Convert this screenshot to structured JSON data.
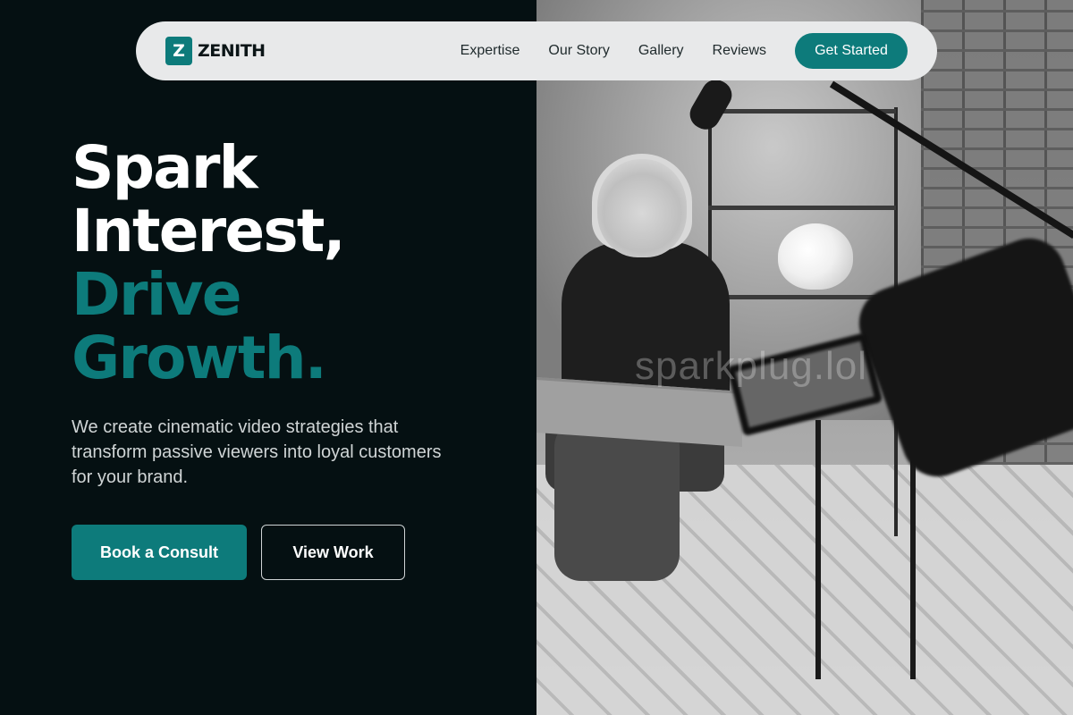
{
  "nav": {
    "logo_mark": "Z",
    "logo_text": "ZENITH",
    "links": [
      "Expertise",
      "Our Story",
      "Gallery",
      "Reviews"
    ],
    "cta": "Get Started"
  },
  "hero": {
    "title_line1": "Spark",
    "title_line2": "Interest,",
    "title_line3": "Drive",
    "title_line4": "Growth.",
    "subtitle": "We create cinematic video strategies that transform passive viewers into loyal customers for your brand.",
    "primary_button": "Book a Consult",
    "secondary_button": "View Work"
  },
  "image": {
    "watermark": "sparkplug.lol"
  },
  "colors": {
    "accent": "#0d7b7b",
    "background": "#051012",
    "nav_bg": "#e8e9ea"
  }
}
